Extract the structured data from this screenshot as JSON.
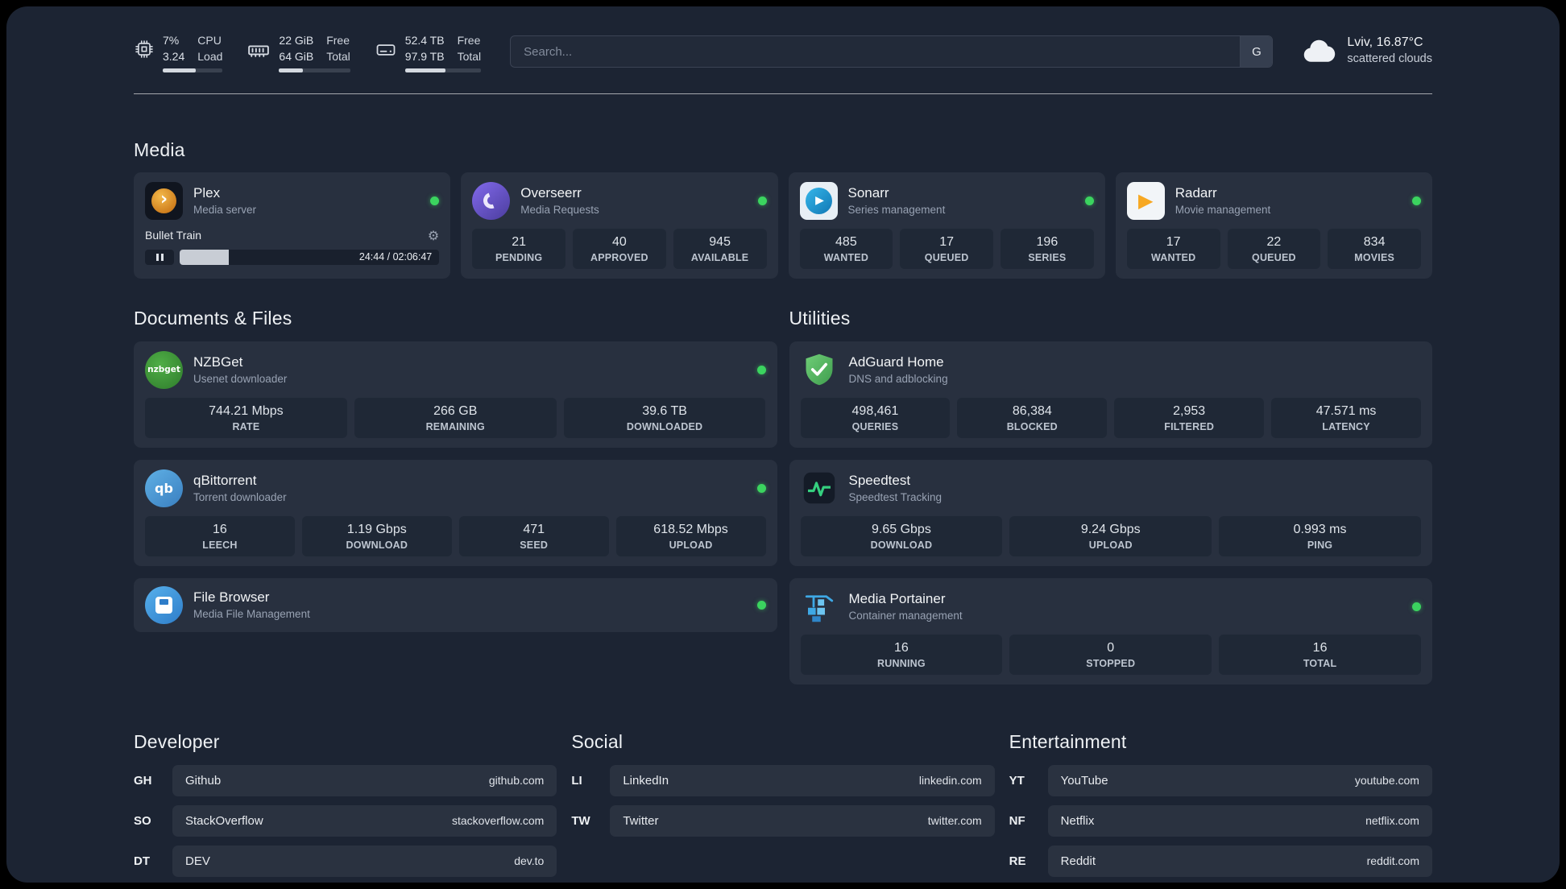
{
  "icons": {
    "gear": "⚙",
    "plex_chevron": "›",
    "play": "▶"
  },
  "topbar": {
    "cpu": {
      "value_top": "7%",
      "value_bottom": "3.24",
      "label_top": "CPU",
      "label_bottom": "Load",
      "progress": 55
    },
    "ram": {
      "value_top": "22 GiB",
      "value_bottom": "64 GiB",
      "label_top": "Free",
      "label_bottom": "Total",
      "progress": 34
    },
    "disk": {
      "value_top": "52.4 TB",
      "value_bottom": "97.9 TB",
      "label_top": "Free",
      "label_bottom": "Total",
      "progress": 53
    },
    "search": {
      "placeholder": "Search...",
      "button_label": "G"
    },
    "weather": {
      "location": "Lviv, 16.87°C",
      "condition": "scattered clouds"
    }
  },
  "media": {
    "title": "Media",
    "plex": {
      "name": "Plex",
      "subtitle": "Media server",
      "now_playing": "Bullet Train",
      "time": "24:44 / 02:06:47",
      "progress": 19
    },
    "overseerr": {
      "name": "Overseerr",
      "subtitle": "Media Requests",
      "stats": [
        {
          "value": "21",
          "label": "PENDING"
        },
        {
          "value": "40",
          "label": "APPROVED"
        },
        {
          "value": "945",
          "label": "AVAILABLE"
        }
      ]
    },
    "sonarr": {
      "name": "Sonarr",
      "subtitle": "Series management",
      "stats": [
        {
          "value": "485",
          "label": "WANTED"
        },
        {
          "value": "17",
          "label": "QUEUED"
        },
        {
          "value": "196",
          "label": "SERIES"
        }
      ]
    },
    "radarr": {
      "name": "Radarr",
      "subtitle": "Movie management",
      "stats": [
        {
          "value": "17",
          "label": "WANTED"
        },
        {
          "value": "22",
          "label": "QUEUED"
        },
        {
          "value": "834",
          "label": "MOVIES"
        }
      ]
    }
  },
  "documents": {
    "title": "Documents & Files",
    "nzbget": {
      "name": "NZBGet",
      "subtitle": "Usenet downloader",
      "icon_text": "nzbget",
      "stats": [
        {
          "value": "744.21 Mbps",
          "label": "RATE"
        },
        {
          "value": "266 GB",
          "label": "REMAINING"
        },
        {
          "value": "39.6 TB",
          "label": "DOWNLOADED"
        }
      ]
    },
    "qbittorrent": {
      "name": "qBittorrent",
      "subtitle": "Torrent downloader",
      "icon_text": "qb",
      "stats": [
        {
          "value": "16",
          "label": "LEECH"
        },
        {
          "value": "1.19 Gbps",
          "label": "DOWNLOAD"
        },
        {
          "value": "471",
          "label": "SEED"
        },
        {
          "value": "618.52 Mbps",
          "label": "UPLOAD"
        }
      ]
    },
    "filebrowser": {
      "name": "File Browser",
      "subtitle": "Media File Management"
    }
  },
  "utilities": {
    "title": "Utilities",
    "adguard": {
      "name": "AdGuard Home",
      "subtitle": "DNS and adblocking",
      "stats": [
        {
          "value": "498,461",
          "label": "QUERIES"
        },
        {
          "value": "86,384",
          "label": "BLOCKED"
        },
        {
          "value": "2,953",
          "label": "FILTERED"
        },
        {
          "value": "47.571 ms",
          "label": "LATENCY"
        }
      ]
    },
    "speedtest": {
      "name": "Speedtest",
      "subtitle": "Speedtest Tracking",
      "stats": [
        {
          "value": "9.65 Gbps",
          "label": "DOWNLOAD"
        },
        {
          "value": "9.24 Gbps",
          "label": "UPLOAD"
        },
        {
          "value": "0.993 ms",
          "label": "PING"
        }
      ]
    },
    "portainer": {
      "name": "Media Portainer",
      "subtitle": "Container management",
      "stats": [
        {
          "value": "16",
          "label": "RUNNING"
        },
        {
          "value": "0",
          "label": "STOPPED"
        },
        {
          "value": "16",
          "label": "TOTAL"
        }
      ]
    }
  },
  "bookmarks": {
    "developer": {
      "title": "Developer",
      "items": [
        {
          "abbr": "GH",
          "name": "Github",
          "url": "github.com"
        },
        {
          "abbr": "SO",
          "name": "StackOverflow",
          "url": "stackoverflow.com"
        },
        {
          "abbr": "DT",
          "name": "DEV",
          "url": "dev.to"
        }
      ]
    },
    "social": {
      "title": "Social",
      "items": [
        {
          "abbr": "LI",
          "name": "LinkedIn",
          "url": "linkedin.com"
        },
        {
          "abbr": "TW",
          "name": "Twitter",
          "url": "twitter.com"
        }
      ]
    },
    "entertainment": {
      "title": "Entertainment",
      "items": [
        {
          "abbr": "YT",
          "name": "YouTube",
          "url": "youtube.com"
        },
        {
          "abbr": "NF",
          "name": "Netflix",
          "url": "netflix.com"
        },
        {
          "abbr": "RE",
          "name": "Reddit",
          "url": "reddit.com"
        }
      ]
    }
  }
}
